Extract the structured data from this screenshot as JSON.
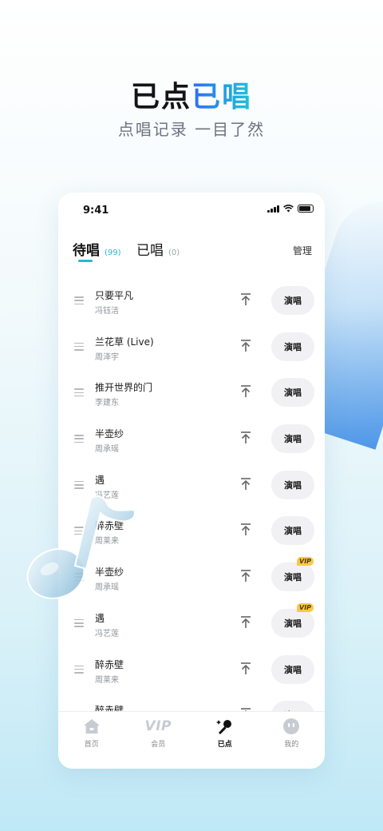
{
  "hero": {
    "title_part1": "已点",
    "title_part2": "已唱",
    "subtitle": "点唱记录 一目了然"
  },
  "status_bar": {
    "time": "9:41"
  },
  "tabs": [
    {
      "label": "待唱",
      "count": "(99)",
      "active": true
    },
    {
      "label": "已唱",
      "count": "(0)",
      "active": false
    }
  ],
  "manage_label": "管理",
  "sing_label": "演唱",
  "vip_badge": "VIP",
  "songs": [
    {
      "title": "只要平凡",
      "artist": "冯钰洁",
      "vip": false
    },
    {
      "title": "兰花草 (Live)",
      "artist": "周泽宇",
      "vip": false
    },
    {
      "title": "推开世界的门",
      "artist": "李建东",
      "vip": false
    },
    {
      "title": "半壶纱",
      "artist": "周承瑶",
      "vip": false
    },
    {
      "title": "遇",
      "artist": "冯艺莲",
      "vip": false
    },
    {
      "title": "醉赤壁",
      "artist": "周莱来",
      "vip": false
    },
    {
      "title": "半壶纱",
      "artist": "周承瑶",
      "vip": true
    },
    {
      "title": "遇",
      "artist": "冯艺莲",
      "vip": true
    },
    {
      "title": "醉赤壁",
      "artist": "周莱来",
      "vip": false
    },
    {
      "title": "醉赤壁",
      "artist": "",
      "vip": false
    }
  ],
  "bottom_nav": [
    {
      "label": "首页",
      "icon": "home-icon"
    },
    {
      "label": "会员",
      "icon": "vip-icon",
      "icon_text": "VIP"
    },
    {
      "label": "已点",
      "icon": "microphone-icon",
      "active": true
    },
    {
      "label": "我的",
      "icon": "profile-face-icon"
    }
  ],
  "colors": {
    "accent": "#2ab6d2",
    "vip_gold": "#f7c948"
  }
}
